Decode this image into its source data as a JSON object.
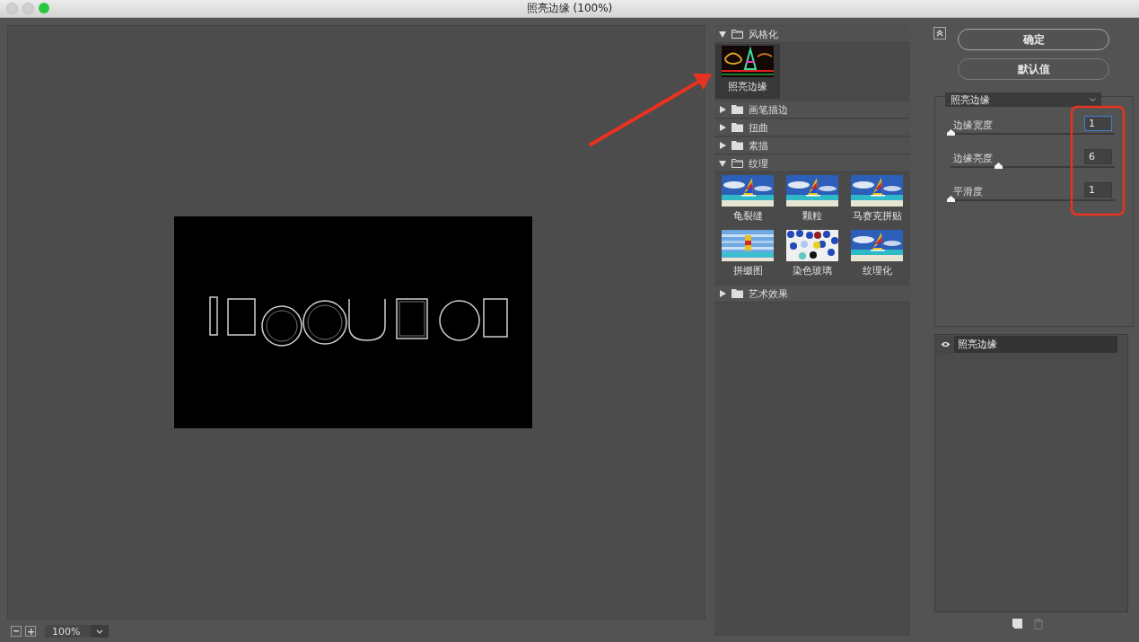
{
  "window": {
    "title": "照亮边缘 (100%)"
  },
  "preview": {
    "kind": "picture",
    "zoom": "100%"
  },
  "gallery": {
    "folders": [
      {
        "label": "风格化",
        "expanded": true,
        "filters": [
          {
            "label": "照亮边缘",
            "selected": true,
            "kind": "glow"
          }
        ]
      },
      {
        "label": "画笔描边",
        "expanded": false
      },
      {
        "label": "扭曲",
        "expanded": false
      },
      {
        "label": "素描",
        "expanded": false
      },
      {
        "label": "纹理",
        "expanded": true,
        "filters": [
          {
            "label": "龟裂缝",
            "selected": false,
            "kind": "sail"
          },
          {
            "label": "颗粒",
            "selected": false,
            "kind": "sail"
          },
          {
            "label": "马赛克拼贴",
            "selected": false,
            "kind": "sail"
          },
          {
            "label": "拼缀图",
            "selected": false,
            "kind": "stripes"
          },
          {
            "label": "染色玻璃",
            "selected": false,
            "kind": "mosaic"
          },
          {
            "label": "纹理化",
            "selected": false,
            "kind": "sail"
          }
        ]
      },
      {
        "label": "艺术效果",
        "expanded": false
      }
    ]
  },
  "buttons": [
    "确定",
    "默认值"
  ],
  "settings": {
    "filter": "照亮边缘",
    "params": [
      {
        "label": "边缘宽度",
        "value": "1",
        "level": 0.0,
        "focused": true
      },
      {
        "label": "边缘亮度",
        "value": "6",
        "level": 0.29,
        "focused": false
      },
      {
        "label": "平滑度",
        "value": "1",
        "level": 0.0,
        "focused": false
      }
    ]
  },
  "layers": [
    {
      "label": "照亮边缘",
      "visible": true,
      "selected": true
    }
  ]
}
